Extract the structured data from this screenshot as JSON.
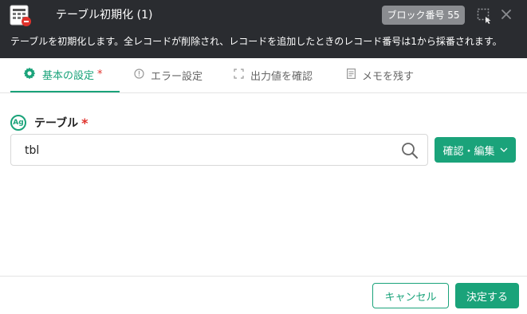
{
  "header": {
    "title": "テーブル初期化 (1)",
    "block_badge": "ブロック番号 55",
    "description": "テーブルを初期化します。全レコードが削除され、レコードを追加したときのレコード番号は1から採番されます。",
    "app_icon": "table-reset-icon",
    "select_icon": "dashed-select-icon",
    "close_icon": "close-icon"
  },
  "tabs": [
    {
      "label": "基本の設定",
      "required_mark": "*",
      "icon": "gear-icon",
      "active": true
    },
    {
      "label": "エラー設定",
      "icon": "info-circle-icon",
      "active": false
    },
    {
      "label": "出力値を確認",
      "icon": "frame-icon",
      "active": false
    },
    {
      "label": "メモを残す",
      "icon": "memo-icon",
      "active": false
    }
  ],
  "field": {
    "type_badge": "Ag",
    "label": "テーブル",
    "required_mark": "*",
    "value": "tbl",
    "search_icon": "search-icon"
  },
  "edit_button": {
    "label": "確認・編集",
    "icon": "chevron-down-icon"
  },
  "footer": {
    "cancel_label": "キャンセル",
    "confirm_label": "決定する"
  },
  "colors": {
    "accent": "#1aa37a",
    "header_bg": "#2a2c30",
    "badge_bg": "#8a8c90",
    "required": "#e0322c"
  }
}
